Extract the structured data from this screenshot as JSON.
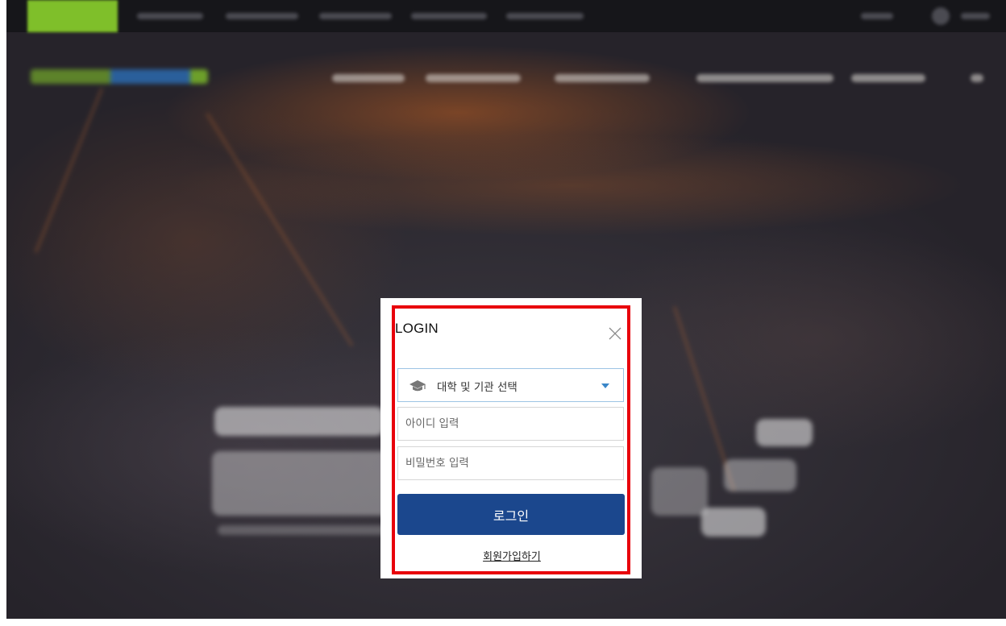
{
  "modal": {
    "title": "LOGIN",
    "institution_select": {
      "selected": "대학 및 기관 선택"
    },
    "id_field": {
      "placeholder": "아이디 입력"
    },
    "password_field": {
      "placeholder": "비밀번호 입력"
    },
    "login_button_label": "로그인",
    "signup_link_label": "회원가입하기"
  },
  "icons": {
    "close": "close-icon",
    "institution": "graduation-cap-icon",
    "dropdown": "caret-down-icon"
  },
  "colors": {
    "login_button": "#1b478d",
    "highlight_border": "#e8000b",
    "select_border": "#9dc4e4",
    "brand_green": "#7fbf2a"
  }
}
